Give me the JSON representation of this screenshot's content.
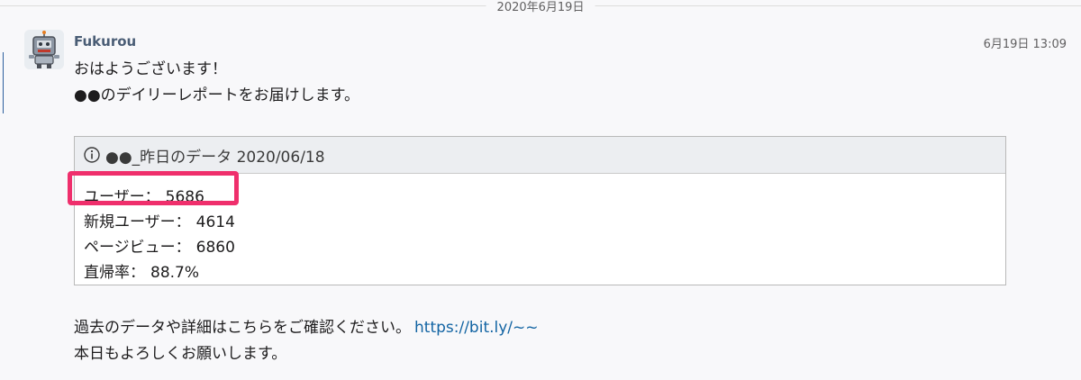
{
  "divider": {
    "date": "2020年6月19日"
  },
  "message": {
    "sender": "Fukurou",
    "timestamp": "6月19日 13:09",
    "lines": [
      "おはようございます！",
      "●●のデイリーレポートをお届けします。"
    ]
  },
  "card": {
    "title": "●●_昨日のデータ 2020/06/18",
    "rows": [
      {
        "label": "ユーザー：",
        "value": "5686"
      },
      {
        "label": "新規ユーザー：",
        "value": "4614"
      },
      {
        "label": "ページビュー：",
        "value": "6860"
      },
      {
        "label": "直帰率：",
        "value": "88.7%"
      }
    ]
  },
  "footer": {
    "line1_text": "過去のデータや詳細はこちらをご確認ください。",
    "link_text": "https://bit.ly/~~",
    "line2": "本日もよろしくお願いします。"
  },
  "colors": {
    "highlight": "#ef2f6c",
    "link": "#1264a3",
    "sender": "#4a5d75"
  },
  "icons": {
    "avatar": "robot-avatar-icon",
    "card_header": "info-icon"
  }
}
